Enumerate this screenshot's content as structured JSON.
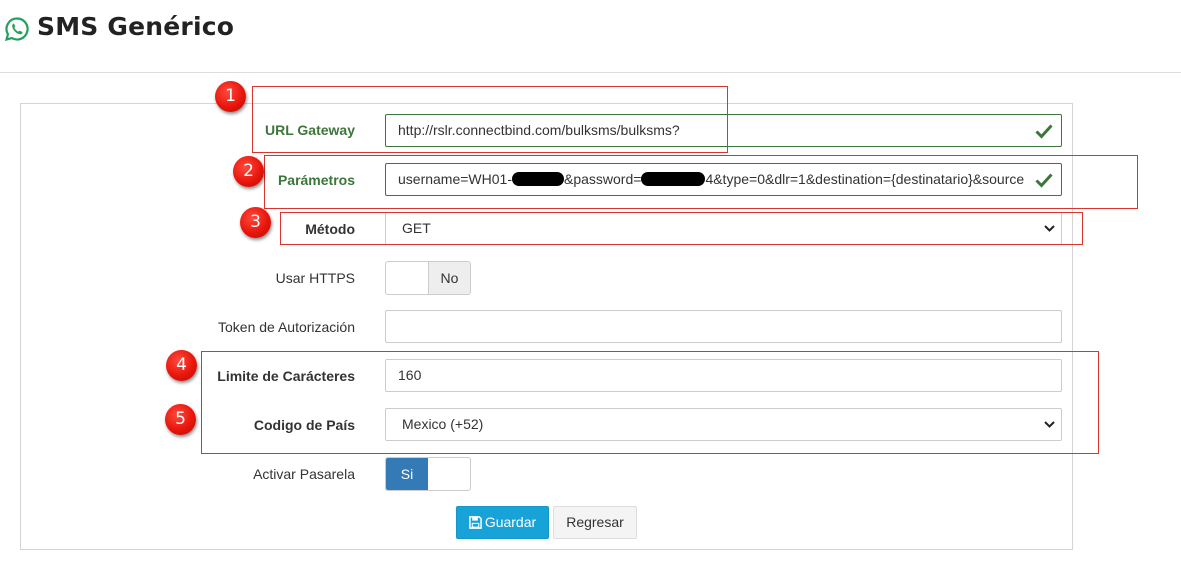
{
  "header": {
    "title": "SMS Genérico",
    "icon": "whatsapp-icon"
  },
  "form": {
    "url_gateway": {
      "label": "URL Gateway",
      "value": "http://rslr.connectbind.com/bulksms/bulksms?"
    },
    "parametros": {
      "label": "Parámetros",
      "value_part1": "username=WH01-",
      "value_part2": "&password=",
      "value_part3": "4&type=0&dlr=1&destination={destinatario}&source"
    },
    "metodo": {
      "label": "Método",
      "value": "GET"
    },
    "usar_https": {
      "label": "Usar HTTPS",
      "value": "No"
    },
    "token": {
      "label": "Token de Autorización",
      "value": ""
    },
    "limite": {
      "label": "Limite de Carácteres",
      "value": "160"
    },
    "codigo_pais": {
      "label": "Codigo de País",
      "value": "Mexico (+52)"
    },
    "activar_pasarela": {
      "label": "Activar Pasarela",
      "value": "Si"
    }
  },
  "buttons": {
    "save": "Guardar",
    "back": "Regresar"
  },
  "annotations": [
    "1",
    "2",
    "3",
    "4",
    "5"
  ],
  "colors": {
    "valid_green": "#3c763d",
    "primary": "#337ab7",
    "save_button": "#17a2d8",
    "annotation_red": "#e8160c"
  }
}
